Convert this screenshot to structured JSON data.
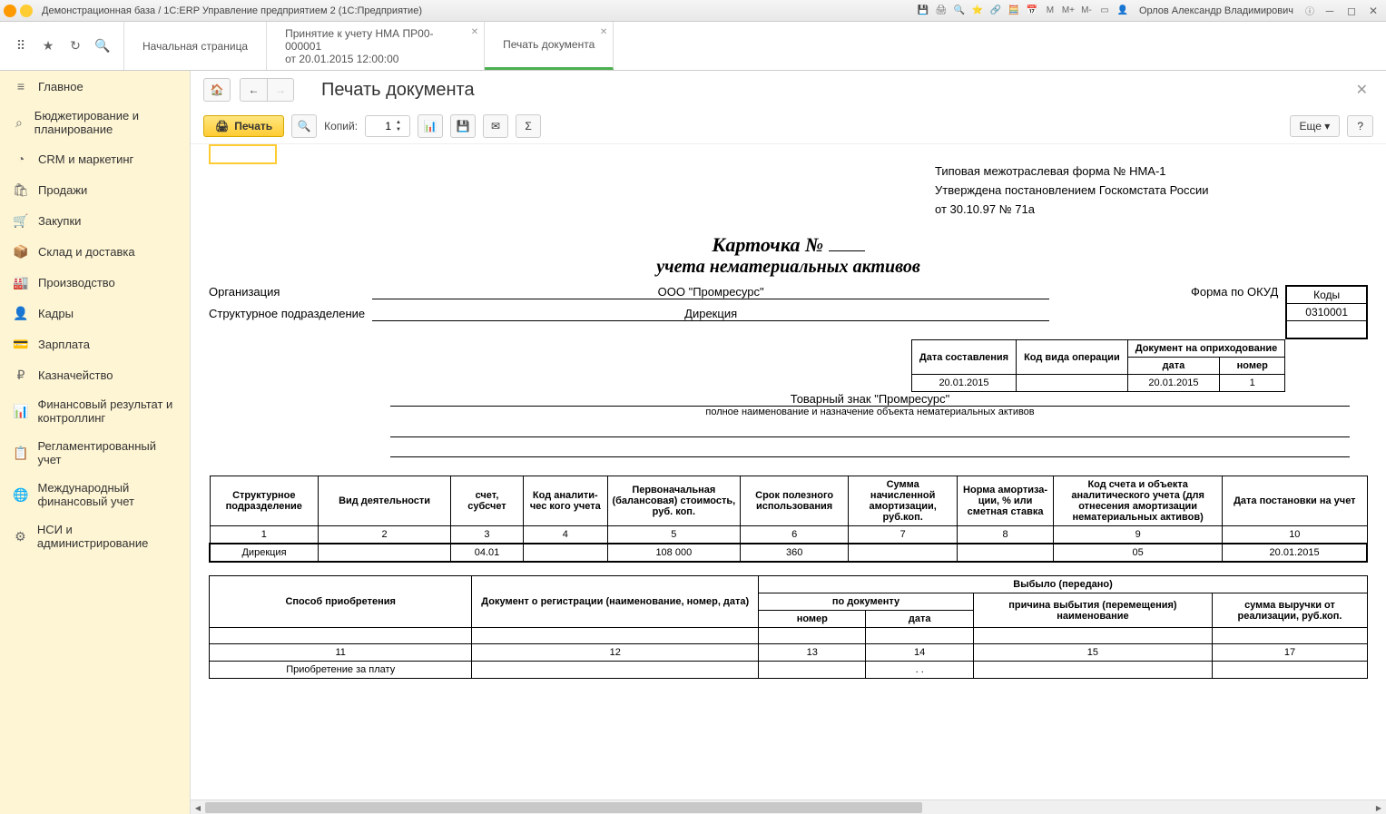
{
  "titlebar": {
    "title": "Демонстрационная база / 1С:ERP Управление предприятием 2  (1С:Предприятие)",
    "user": "Орлов Александр Владимирович",
    "m": "M",
    "mplus": "M+",
    "mminus": "M-"
  },
  "tabs": {
    "start": "Начальная страница",
    "doc1_l1": "Принятие к учету НМА ПР00-000001",
    "doc1_l2": "от 20.01.2015 12:00:00",
    "print": "Печать документа"
  },
  "sidebar": [
    {
      "icon": "≡",
      "label": "Главное"
    },
    {
      "icon": "⌕",
      "label": "Бюджетирование и планирование"
    },
    {
      "icon": "◔",
      "label": "CRM и маркетинг"
    },
    {
      "icon": "🛍",
      "label": "Продажи"
    },
    {
      "icon": "🛒",
      "label": "Закупки"
    },
    {
      "icon": "📦",
      "label": "Склад и доставка"
    },
    {
      "icon": "🏭",
      "label": "Производство"
    },
    {
      "icon": "👤",
      "label": "Кадры"
    },
    {
      "icon": "💳",
      "label": "Зарплата"
    },
    {
      "icon": "₽",
      "label": "Казначейство"
    },
    {
      "icon": "📊",
      "label": "Финансовый результат и контроллинг"
    },
    {
      "icon": "📋",
      "label": "Регламентированный учет"
    },
    {
      "icon": "🌐",
      "label": "Международный финансовый учет"
    },
    {
      "icon": "⚙",
      "label": "НСИ и администрирование"
    }
  ],
  "content_header": {
    "title": "Печать документа"
  },
  "print_toolbar": {
    "print": "Печать",
    "copies_label": "Копий:",
    "copies_value": "1",
    "more": "Еще",
    "help": "?"
  },
  "doc": {
    "approval1": "Типовая межотраслевая форма № НМА-1",
    "approval2": "Утверждена постановлением Госкомстата России",
    "approval3": "от 30.10.97 № 71а",
    "title": "Карточка  №",
    "subtitle": "учета нематериальных активов",
    "codes_head": "Коды",
    "okud_val": "0310001",
    "org_label": "Организация",
    "org_val": "ООО \"Промресурс\"",
    "okud_label": "Форма по ОКУД",
    "dept_label": "Структурное подразделение",
    "dept_val": "Дирекция",
    "st_date_head": "Дата составления",
    "st_op_head": "Код вида операции",
    "st_doc_head": "Документ на оприходование",
    "st_doc_date": "дата",
    "st_doc_num": "номер",
    "st_date_val": "20.01.2015",
    "st_doc_date_val": "20.01.2015",
    "st_doc_num_val": "1",
    "obj_val": "Товарный знак \"Промресурс\"",
    "obj_caption": "полное наименование и назначение объекта нематериальных активов",
    "mt_h1": "Структурное подразделение",
    "mt_h2": "Вид деятельности",
    "mt_h3": "счет, субсчет",
    "mt_h4": "Код аналити-чес кого учета",
    "mt_h5": "Первоначальная (балансовая) стоимость, руб. коп.",
    "mt_h6": "Срок полезного использования",
    "mt_h7": "Сумма начисленной амортизации, руб.коп.",
    "mt_h8": "Норма амортиза-ции, % или сметная ставка",
    "mt_h9": "Код счета и объекта аналитического учета (для отнесения амортизации нематериальных активов)",
    "mt_h10": "Дата постановки на учет",
    "mt_n1": "1",
    "mt_n2": "2",
    "mt_n3": "3",
    "mt_n4": "4",
    "mt_n5": "5",
    "mt_n6": "6",
    "mt_n7": "7",
    "mt_n8": "8",
    "mt_n9": "9",
    "mt_n10": "10",
    "mt_v1": "Дирекция",
    "mt_v3": "04.01",
    "mt_v5": "108 000",
    "mt_v6": "360",
    "mt_v9": "05",
    "mt_v10": "20.01.2015",
    "dt_h11": "Способ приобретения",
    "dt_h12": "Документ о регистрации (наименование, номер, дата)",
    "dt_hout": "Выбыло (передано)",
    "dt_hdoc": "по документу",
    "dt_hreason": "причина выбытия (перемещения) наименование",
    "dt_hrev": "сумма выручки от реализации, руб.коп.",
    "dt_hnum": "номер",
    "dt_hdate": "дата",
    "dt_n11": "11",
    "dt_n12": "12",
    "dt_n13": "13",
    "dt_n14": "14",
    "dt_n15": "15",
    "dt_n17": "17",
    "dt_v11": "Приобретение за плату",
    "dt_v14": ". ."
  }
}
